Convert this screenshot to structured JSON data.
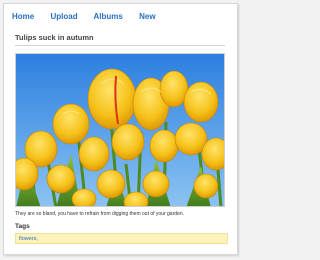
{
  "nav": {
    "items": [
      "Home",
      "Upload",
      "Albums",
      "New"
    ]
  },
  "photo": {
    "title": "Tulips suck in autumn",
    "caption": "They are so bland, you have to refrain from digging them out of your garden."
  },
  "tags": {
    "heading": "Tags",
    "value": "flowers,"
  },
  "colors": {
    "link": "#2a6fc4",
    "tag_bg": "#fdf2b8",
    "sky": "#3f8fe0",
    "tulip": "#f6c21a"
  }
}
